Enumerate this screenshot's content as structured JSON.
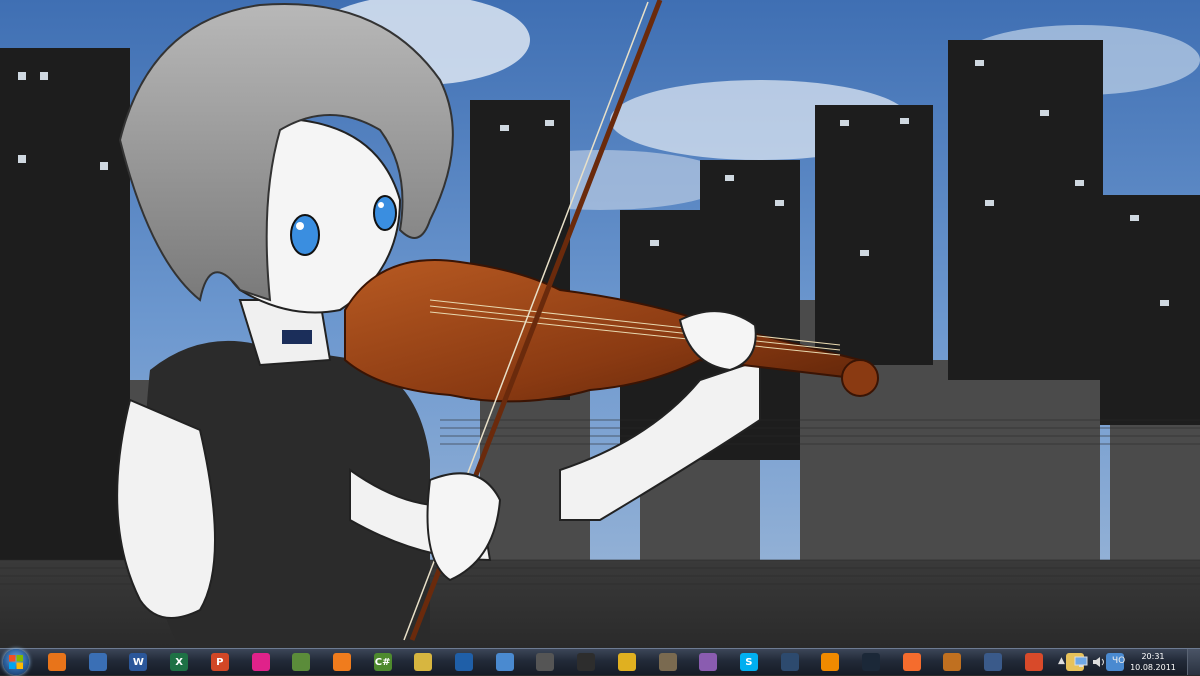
{
  "wallpaper": {
    "sky_color": "#4a78b8",
    "building_color": "#1f1f1f",
    "violin_color": "#8a3a12"
  },
  "taskbar": {
    "start_icon": "windows-logo-icon",
    "pinned": [
      {
        "name": "firefox-icon",
        "label": "",
        "color": "#e8741a"
      },
      {
        "name": "thunderbird-icon",
        "label": "",
        "color": "#3a6fb5"
      },
      {
        "name": "word-icon",
        "label": "W",
        "color": "#2b579a"
      },
      {
        "name": "excel-icon",
        "label": "X",
        "color": "#1e7145"
      },
      {
        "name": "powerpoint-icon",
        "label": "P",
        "color": "#d24726"
      },
      {
        "name": "itunes-icon",
        "label": "",
        "color": "#e0228a"
      },
      {
        "name": "notepad-icon",
        "label": "",
        "color": "#5b8c3a"
      },
      {
        "name": "xampp-icon",
        "label": "",
        "color": "#f07c1d"
      },
      {
        "name": "csharp-icon",
        "label": "C#",
        "color": "#4e8a2e"
      },
      {
        "name": "picture-icon",
        "label": "",
        "color": "#d7b640"
      },
      {
        "name": "virtualbox-icon",
        "label": "",
        "color": "#1f5fa8"
      },
      {
        "name": "paint-icon",
        "label": "",
        "color": "#4a8ad0"
      },
      {
        "name": "car-icon",
        "label": "",
        "color": "#555555"
      },
      {
        "name": "inkscape-icon",
        "label": "",
        "color": "#2d2d2d"
      },
      {
        "name": "lock-icon",
        "label": "",
        "color": "#e0b020"
      },
      {
        "name": "audio-icon",
        "label": "",
        "color": "#7a6a50"
      },
      {
        "name": "pidgin-icon",
        "label": "",
        "color": "#8a5cb0"
      },
      {
        "name": "skype-icon",
        "label": "S",
        "color": "#00aff0"
      },
      {
        "name": "steam-alt-icon",
        "label": "",
        "color": "#2d4a6e"
      },
      {
        "name": "vlc-icon",
        "label": "",
        "color": "#f08a00"
      },
      {
        "name": "steam-icon",
        "label": "",
        "color": "#1b2838"
      },
      {
        "name": "origin-icon",
        "label": "",
        "color": "#f56c2d"
      },
      {
        "name": "game-icon",
        "label": "",
        "color": "#c07020"
      },
      {
        "name": "photo-icon",
        "label": "",
        "color": "#3a5a8a"
      },
      {
        "name": "browser-icon",
        "label": "",
        "color": "#d84a2a"
      },
      {
        "name": "explorer-folder-icon",
        "label": "",
        "color": "#e8c25a"
      },
      {
        "name": "control-panel-icon",
        "label": "",
        "color": "#4a8ad0"
      }
    ],
    "tray": {
      "chevron": "▲",
      "language": "ЧО",
      "time": "20:31",
      "date": "10.08.2011"
    }
  }
}
